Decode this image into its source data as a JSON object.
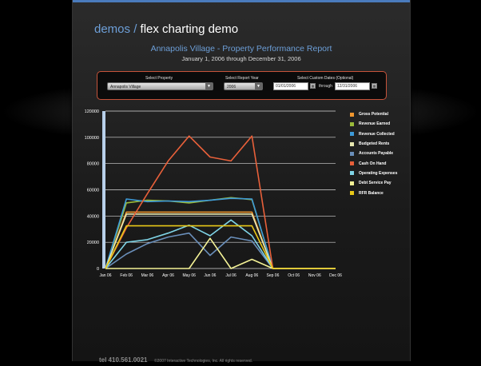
{
  "header": {
    "brand_demos": "demos",
    "brand_separator": "/",
    "brand_title": "flex charting demo"
  },
  "report": {
    "title": "Annapolis Village - Property Performance Report",
    "subtitle": "January 1, 2006 through December 31, 2006"
  },
  "filters": {
    "property_label": "Select Property",
    "property_value": "Annapolis Village",
    "year_label": "Select Report Year",
    "year_value": "2006",
    "dates_label": "Select Custom Dates (Optional)",
    "start_date": "01/01/2006",
    "through_label": "through",
    "end_date": "12/31/2006"
  },
  "footer": {
    "phone": "tel 410.561.0021",
    "copyright": "©2007 Interactive Technologies, Inc. All rights reserved."
  },
  "colors": {
    "accent_blue": "#6d9fd8",
    "filter_border": "#c6533a"
  },
  "chart_data": {
    "type": "line",
    "categories": [
      "Jan 06",
      "Feb 06",
      "Mar 06",
      "Apr 06",
      "May 06",
      "Jun 06",
      "Jul 06",
      "Aug 06",
      "Sep 06",
      "Oct 06",
      "Nov 06",
      "Dec 06"
    ],
    "ylim": [
      0,
      120000
    ],
    "yticks": [
      0,
      20000,
      40000,
      60000,
      80000,
      100000,
      120000
    ],
    "grid": true,
    "legend_position": "right",
    "series": [
      {
        "name": "Gross Potential",
        "color": "#f0962e",
        "values": [
          0,
          43000,
          43000,
          43000,
          43000,
          43000,
          43000,
          43000,
          0,
          0,
          0,
          0
        ]
      },
      {
        "name": "Revenue Earned",
        "color": "#9bbb3a",
        "values": [
          0,
          50000,
          52000,
          51500,
          50000,
          52000,
          54000,
          52500,
          0,
          0,
          0,
          0
        ]
      },
      {
        "name": "Revenue Collected",
        "color": "#3d9ad8",
        "values": [
          0,
          53000,
          51000,
          51500,
          51000,
          52000,
          53500,
          53000,
          0,
          0,
          0,
          0
        ]
      },
      {
        "name": "Budgeted Rents",
        "color": "#e8e8b0",
        "values": [
          0,
          41500,
          41500,
          41500,
          41500,
          41500,
          41500,
          41500,
          0,
          0,
          0,
          0
        ]
      },
      {
        "name": "Accounts Payable",
        "color": "#6a8fba",
        "values": [
          0,
          11000,
          19000,
          24000,
          27000,
          10000,
          24000,
          21000,
          0,
          0,
          0,
          0
        ]
      },
      {
        "name": "Cash On Hand",
        "color": "#e8603a",
        "values": [
          0,
          31000,
          57000,
          82000,
          101000,
          85000,
          82000,
          101000,
          0,
          0,
          0,
          0
        ]
      },
      {
        "name": "Operating Expenses",
        "color": "#7fd4e6",
        "values": [
          0,
          20000,
          22000,
          27000,
          33000,
          25000,
          37000,
          25000,
          0,
          0,
          0,
          0
        ]
      },
      {
        "name": "Debt Service Pay",
        "color": "#f4f296",
        "values": [
          0,
          0,
          0,
          0,
          0,
          23000,
          0,
          7000,
          0,
          0,
          0,
          0
        ]
      },
      {
        "name": "RFR Balance",
        "color": "#e8c818",
        "values": [
          0,
          32500,
          32500,
          32500,
          32500,
          32500,
          32500,
          32500,
          0,
          0,
          0,
          0
        ]
      }
    ]
  }
}
